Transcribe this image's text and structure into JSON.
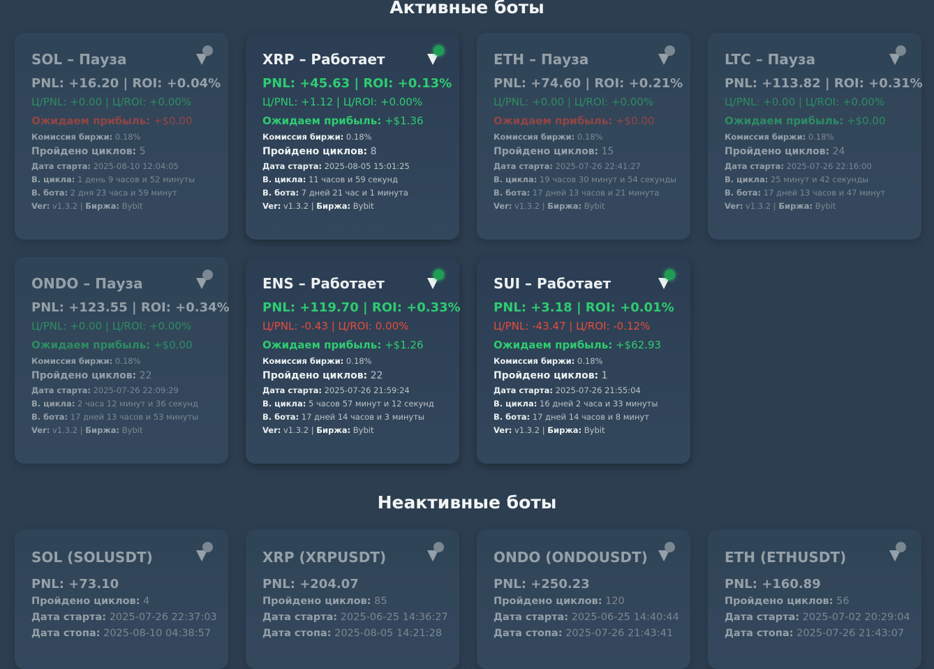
{
  "sections": {
    "active_title": "Активные боты",
    "inactive_title": "Неактивные боты"
  },
  "labels": {
    "expected": "Ожидаем прибыль:",
    "fee": "Комиссия биржи:",
    "cycles": "Пройдено циклов:",
    "start": "Дата старта:",
    "cycle_time": "В. цикла:",
    "bot_time": "В. бота:",
    "ver": "Ver:",
    "exchange": "Биржа:",
    "stop": "Дата стопа:"
  },
  "colors": {
    "bg": "#2c3e50",
    "green": "#2ecc71",
    "red": "#e74c3c",
    "running_dot": "#1f9d55"
  },
  "active_bots": [
    {
      "title": "SOL – Пауза",
      "status": "paused",
      "pnl": "PNL: +16.20 | ROI: +0.04%",
      "cpnl": "Ц/PNL: +0.00 | Ц/ROI: +0.00%",
      "cpnl_color": "green",
      "expected": "+$0.00",
      "expected_color": "red",
      "fee": "0.18%",
      "cycles": "5",
      "start": "2025-08-10 12:04:05",
      "cycle_time": "1 день 9 часов и 52 минуты",
      "bot_time": "2 дня 23 часа и 59 минут",
      "ver": "v1.3.2",
      "exchange": "Bybit",
      "icon": "play-pause-icon"
    },
    {
      "title": "XRP – Работает",
      "status": "running",
      "pnl": "PNL: +45.63 | ROI: +0.13%",
      "cpnl": "Ц/PNL: +1.12 | Ц/ROI: +0.00%",
      "cpnl_color": "green",
      "expected": "+$1.36",
      "expected_color": "green",
      "fee": "0.18%",
      "cycles": "8",
      "start": "2025-08-05 15:01:25",
      "cycle_time": "11 часов и 59 секунд",
      "bot_time": "7 дней 21 час и 1 минута",
      "ver": "v1.3.2",
      "exchange": "Bybit",
      "icon": "running-status-icon"
    },
    {
      "title": "ETH – Пауза",
      "status": "paused",
      "pnl": "PNL: +74.60 | ROI: +0.21%",
      "cpnl": "Ц/PNL: +0.00 | Ц/ROI: +0.00%",
      "cpnl_color": "green",
      "expected": "+$0.00",
      "expected_color": "red",
      "fee": "0.18%",
      "cycles": "15",
      "start": "2025-07-26 22:41:27",
      "cycle_time": "19 часов 30 минут и 54 секунды",
      "bot_time": "17 дней 13 часов и 21 минута",
      "ver": "v1.3.2",
      "exchange": "Bybit",
      "icon": "play-pause-icon"
    },
    {
      "title": "LTC – Пауза",
      "status": "paused",
      "pnl": "PNL: +113.82 | ROI: +0.31%",
      "cpnl": "Ц/PNL: +0.00 | Ц/ROI: +0.00%",
      "cpnl_color": "green",
      "expected": "+$0.00",
      "expected_color": "green",
      "fee": "0.18%",
      "cycles": "24",
      "start": "2025-07-26 22:16:00",
      "cycle_time": "25 минут и 42 секунды",
      "bot_time": "17 дней 13 часов и 47 минут",
      "ver": "v1.3.2",
      "exchange": "Bybit",
      "icon": "play-pause-icon"
    },
    {
      "title": "ONDO – Пауза",
      "status": "paused",
      "pnl": "PNL: +123.55 | ROI: +0.34%",
      "cpnl": "Ц/PNL: +0.00 | Ц/ROI: +0.00%",
      "cpnl_color": "green",
      "expected": "+$0.00",
      "expected_color": "green",
      "fee": "0.18%",
      "cycles": "22",
      "start": "2025-07-26 22:09:29",
      "cycle_time": "2 часа 12 минут и 36 секунд",
      "bot_time": "17 дней 13 часов и 53 минуты",
      "ver": "v1.3.2",
      "exchange": "Bybit",
      "icon": "play-pause-icon"
    },
    {
      "title": "ENS – Работает",
      "status": "running",
      "pnl": "PNL: +119.70 | ROI: +0.33%",
      "cpnl": "Ц/PNL: -0.43 | Ц/ROI: 0.00%",
      "cpnl_color": "red",
      "expected": "+$1.26",
      "expected_color": "green",
      "fee": "0.18%",
      "cycles": "22",
      "start": "2025-07-26 21:59:24",
      "cycle_time": "5 часов 57 минут и 12 секунд",
      "bot_time": "17 дней 14 часов и 3 минуты",
      "ver": "v1.3.2",
      "exchange": "Bybit",
      "icon": "running-status-icon"
    },
    {
      "title": "SUI – Работает",
      "status": "running",
      "pnl": "PNL: +3.18 | ROI: +0.01%",
      "cpnl": "Ц/PNL: -43.47 | Ц/ROI: -0.12%",
      "cpnl_color": "red",
      "expected": "+$62.93",
      "expected_color": "green",
      "fee": "0.18%",
      "cycles": "1",
      "start": "2025-07-26 21:55:04",
      "cycle_time": "16 дней 2 часа и 33 минуты",
      "bot_time": "17 дней 14 часов и 8 минут",
      "ver": "v1.3.2",
      "exchange": "Bybit",
      "icon": "running-status-icon"
    }
  ],
  "inactive_bots": [
    {
      "title": "SOL (SOLUSDT)",
      "pnl": "PNL: +73.10",
      "cycles": "4",
      "start": "2025-07-26 22:37:03",
      "stop": "2025-08-10 04:38:57"
    },
    {
      "title": "XRP (XRPUSDT)",
      "pnl": "PNL: +204.07",
      "cycles": "85",
      "start": "2025-06-25 14:36:27",
      "stop": "2025-08-05 14:21:28"
    },
    {
      "title": "ONDO (ONDOUSDT)",
      "pnl": "PNL: +250.23",
      "cycles": "120",
      "start": "2025-06-25 14:40:44",
      "stop": "2025-07-26 21:43:41"
    },
    {
      "title": "ETH (ETHUSDT)",
      "pnl": "PNL: +160.89",
      "cycles": "56",
      "start": "2025-07-02 20:29:04",
      "stop": "2025-07-26 21:43:07"
    }
  ]
}
